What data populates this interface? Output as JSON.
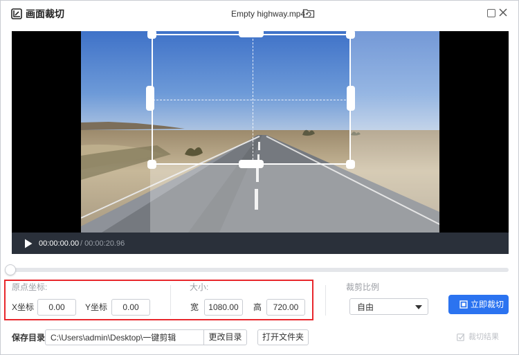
{
  "titlebar": {
    "app_title": "画面裁切",
    "file_name": "Empty highway.mp4"
  },
  "player": {
    "current_time": "00:00:00.00",
    "duration_text": " / 00:00:20.96",
    "progress": 0
  },
  "origin": {
    "section_label": "原点坐标:",
    "x_label": "X坐标",
    "x_value": "0.00",
    "y_label": "Y坐标",
    "y_value": "0.00"
  },
  "size": {
    "section_label": "大小:",
    "width_label": "宽",
    "width_value": "1080.00",
    "height_label": "高",
    "height_value": "720.00"
  },
  "ratio": {
    "section_label": "裁剪比例",
    "selected": "自由"
  },
  "actions": {
    "crop_now": "立即裁切",
    "save_label": "保存目录",
    "save_path": "C:\\Users\\admin\\Desktop\\一键剪辑",
    "change_dir": "更改目录",
    "open_folder": "打开文件夹",
    "result_label": "裁切结果"
  },
  "colors": {
    "accent": "#2b73f0",
    "highlight_border": "#e8262b",
    "controls_bg": "#2a303a"
  }
}
